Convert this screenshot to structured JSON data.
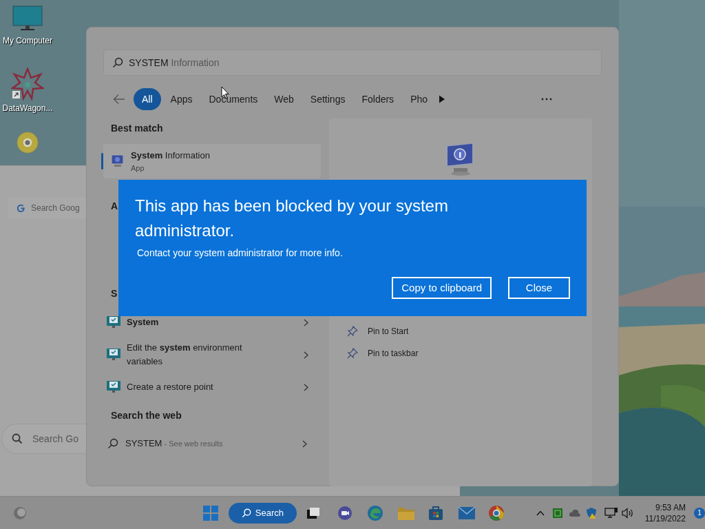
{
  "desktop_icons": [
    {
      "kind": "monitor",
      "label": "My Computer"
    },
    {
      "kind": "star",
      "label": "DataWagon...",
      "shortcut": true
    },
    {
      "kind": "disc"
    }
  ],
  "browser_window": {
    "search_fields": [
      {
        "kind": "google",
        "placeholder": "Search Goog"
      },
      {
        "kind": "pill",
        "placeholder": "Search Go"
      }
    ]
  },
  "search_panel": {
    "query": "SYSTEM",
    "completion": "Information",
    "filters": [
      {
        "label": "All",
        "selected": true
      },
      {
        "label": "Apps",
        "selected": false
      },
      {
        "label": "Documents",
        "selected": false
      },
      {
        "label": "Web",
        "selected": false
      },
      {
        "label": "Settings",
        "selected": false
      },
      {
        "label": "Folders",
        "selected": false
      },
      {
        "label": "Pho",
        "selected": false
      }
    ],
    "best_match": {
      "heading": "Best match",
      "title": "**System** Information",
      "subtitle": "App",
      "selected": true
    },
    "cut_headings": [
      "A",
      "S"
    ],
    "settings_results": [
      {
        "text": "**System**"
      },
      {
        "text": "Edit the **system** environment variables"
      },
      {
        "text": "Create a restore point"
      }
    ],
    "web_heading": "Search the web",
    "web_result": {
      "query": "SYSTEM",
      "suffix": " - See web results"
    },
    "preview_actions": [
      "Pin to Start",
      "Pin to taskbar"
    ]
  },
  "dialog": {
    "title": "This app has been blocked by your system administrator.",
    "message": "Contact your system administrator for more info.",
    "buttons": [
      "Copy to clipboard",
      "Close"
    ]
  },
  "taskbar": {
    "search_label": "Search",
    "time": "9:53 AM",
    "date": "11/19/2022",
    "notification_count": "1"
  }
}
